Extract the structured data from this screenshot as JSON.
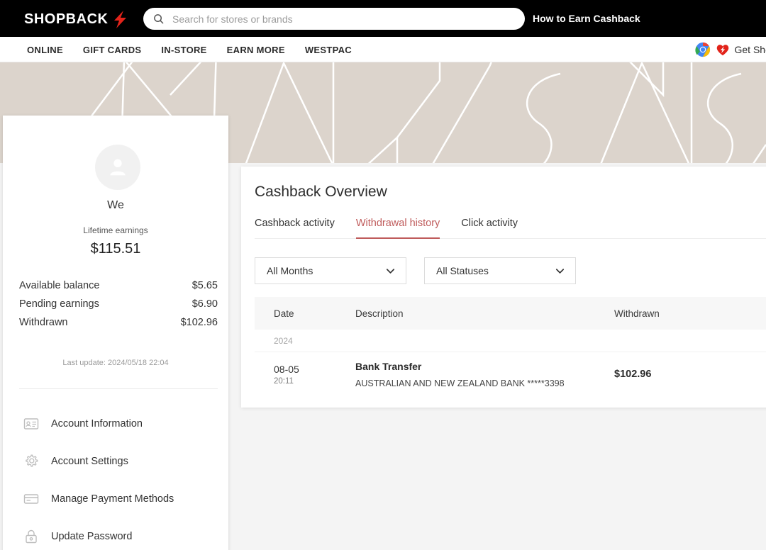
{
  "topbar": {
    "logo_text": "SHOPBACK",
    "logo_icon": "lightning-bolt-icon",
    "search": {
      "icon": "search-icon",
      "placeholder": "Search for stores or brands",
      "value": ""
    },
    "how_to_earn": "How to Earn Cashback"
  },
  "nav": {
    "items": [
      {
        "label": "ONLINE"
      },
      {
        "label": "GIFT CARDS"
      },
      {
        "label": "IN-STORE"
      },
      {
        "label": "EARN MORE"
      },
      {
        "label": "WESTPAC"
      }
    ],
    "extension_cta": {
      "label": "Get ShopB",
      "chrome_icon": "chrome-icon",
      "shopback_icon": "shopback-heart-icon"
    }
  },
  "sidebar": {
    "avatar_icon": "user-avatar-icon",
    "username": "We",
    "lifetime_label": "Lifetime earnings",
    "lifetime_value": "$115.51",
    "stats": [
      {
        "label": "Available balance",
        "value": "$5.65"
      },
      {
        "label": "Pending earnings",
        "value": "$6.90"
      },
      {
        "label": "Withdrawn",
        "value": "$102.96"
      }
    ],
    "last_update": "Last update: 2024/05/18 22:04",
    "menu": [
      {
        "label": "Account Information",
        "icon": "id-card-icon"
      },
      {
        "label": "Account Settings",
        "icon": "gear-icon"
      },
      {
        "label": "Manage Payment Methods",
        "icon": "credit-card-icon"
      },
      {
        "label": "Update Password",
        "icon": "lock-icon"
      }
    ]
  },
  "main": {
    "title": "Cashback Overview",
    "tabs": [
      {
        "label": "Cashback activity",
        "active": false
      },
      {
        "label": "Withdrawal history",
        "active": true
      },
      {
        "label": "Click activity",
        "active": false
      }
    ],
    "filters": [
      {
        "label": "All Months",
        "icon": "chevron-down-icon"
      },
      {
        "label": "All Statuses",
        "icon": "chevron-down-icon"
      }
    ],
    "table": {
      "columns": [
        "Date",
        "Description",
        "Withdrawn"
      ],
      "year_group": "2024",
      "rows": [
        {
          "date": "08-05",
          "time": "20:11",
          "title": "Bank Transfer",
          "subtitle": "AUSTRALIAN AND NEW ZEALAND BANK *****3398",
          "amount": "$102.96"
        }
      ]
    }
  },
  "colors": {
    "accent_red": "#bf5b5b",
    "brand_red": "#e2231a",
    "hero_beige": "#dcd4cc",
    "page_bg": "#f4f4f4"
  }
}
